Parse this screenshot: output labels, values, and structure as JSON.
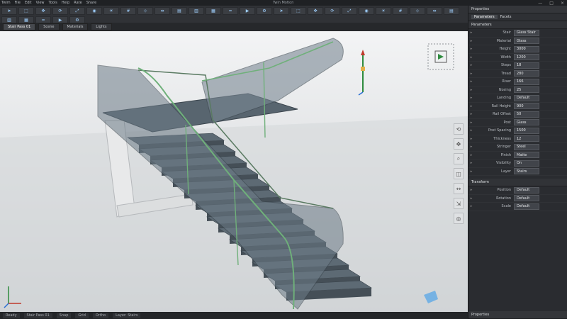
{
  "titlebar": {
    "title": "Twin Motion",
    "menu": [
      "Twim",
      "File",
      "Edit",
      "View",
      "Tools",
      "Help",
      "Rate",
      "Share"
    ],
    "window_controls": [
      "—",
      "□",
      "×"
    ]
  },
  "toolbar": {
    "tool_icons": [
      "arrow-icon",
      "select-icon",
      "move-icon",
      "rotate-icon",
      "scale-icon",
      "camera-icon",
      "light-icon",
      "grid-icon",
      "snap-icon",
      "measure-icon",
      "stairs-icon",
      "wall-icon",
      "glass-icon",
      "rail-icon",
      "render-icon",
      "settings-icon"
    ]
  },
  "tabs": [
    {
      "label": "Stair Pass 01",
      "active": true
    },
    {
      "label": "Scene",
      "active": false
    },
    {
      "label": "Materials",
      "active": false
    },
    {
      "label": "Lights",
      "active": false
    }
  ],
  "viewport": {
    "side_tools": [
      "orbit",
      "pan",
      "zoom",
      "section",
      "move",
      "measure",
      "focus"
    ]
  },
  "panel": {
    "header": "Properties",
    "tabs": [
      "Parameters",
      "Facets"
    ],
    "section_title": "Parameters",
    "rows": [
      {
        "label": "Stair",
        "value": "Glass Stair"
      },
      {
        "label": "Material",
        "value": "Glass"
      },
      {
        "label": "Height",
        "value": "3000"
      },
      {
        "label": "Width",
        "value": "1200"
      },
      {
        "label": "Steps",
        "value": "18"
      },
      {
        "label": "Tread",
        "value": "280"
      },
      {
        "label": "Riser",
        "value": "166"
      },
      {
        "label": "Nosing",
        "value": "25"
      },
      {
        "label": "Landing",
        "value": "Default"
      },
      {
        "label": "Rail Height",
        "value": "900"
      },
      {
        "label": "Rail Offset",
        "value": "50"
      },
      {
        "label": "Post",
        "value": "Glass"
      },
      {
        "label": "Post Spacing",
        "value": "1500"
      },
      {
        "label": "Thickness",
        "value": "12"
      },
      {
        "label": "Stringer",
        "value": "Steel"
      },
      {
        "label": "Finish",
        "value": "Matte"
      },
      {
        "label": "Visibility",
        "value": "On"
      },
      {
        "label": "Layer",
        "value": "Stairs"
      }
    ],
    "section2_title": "Transform",
    "rows2": [
      {
        "label": "Position",
        "value": "Default"
      },
      {
        "label": "Rotation",
        "value": "Default"
      },
      {
        "label": "Scale",
        "value": "Default"
      }
    ],
    "footer": "Properties"
  },
  "statusbar": {
    "items": [
      "Ready",
      "Stair Pass 01",
      "Snap",
      "Grid",
      "Ortho",
      "Layer: Stairs"
    ]
  },
  "colors": {
    "glass": "#5f6e7a",
    "rail": "#6fb07a",
    "accent": "#4fa3e8"
  }
}
